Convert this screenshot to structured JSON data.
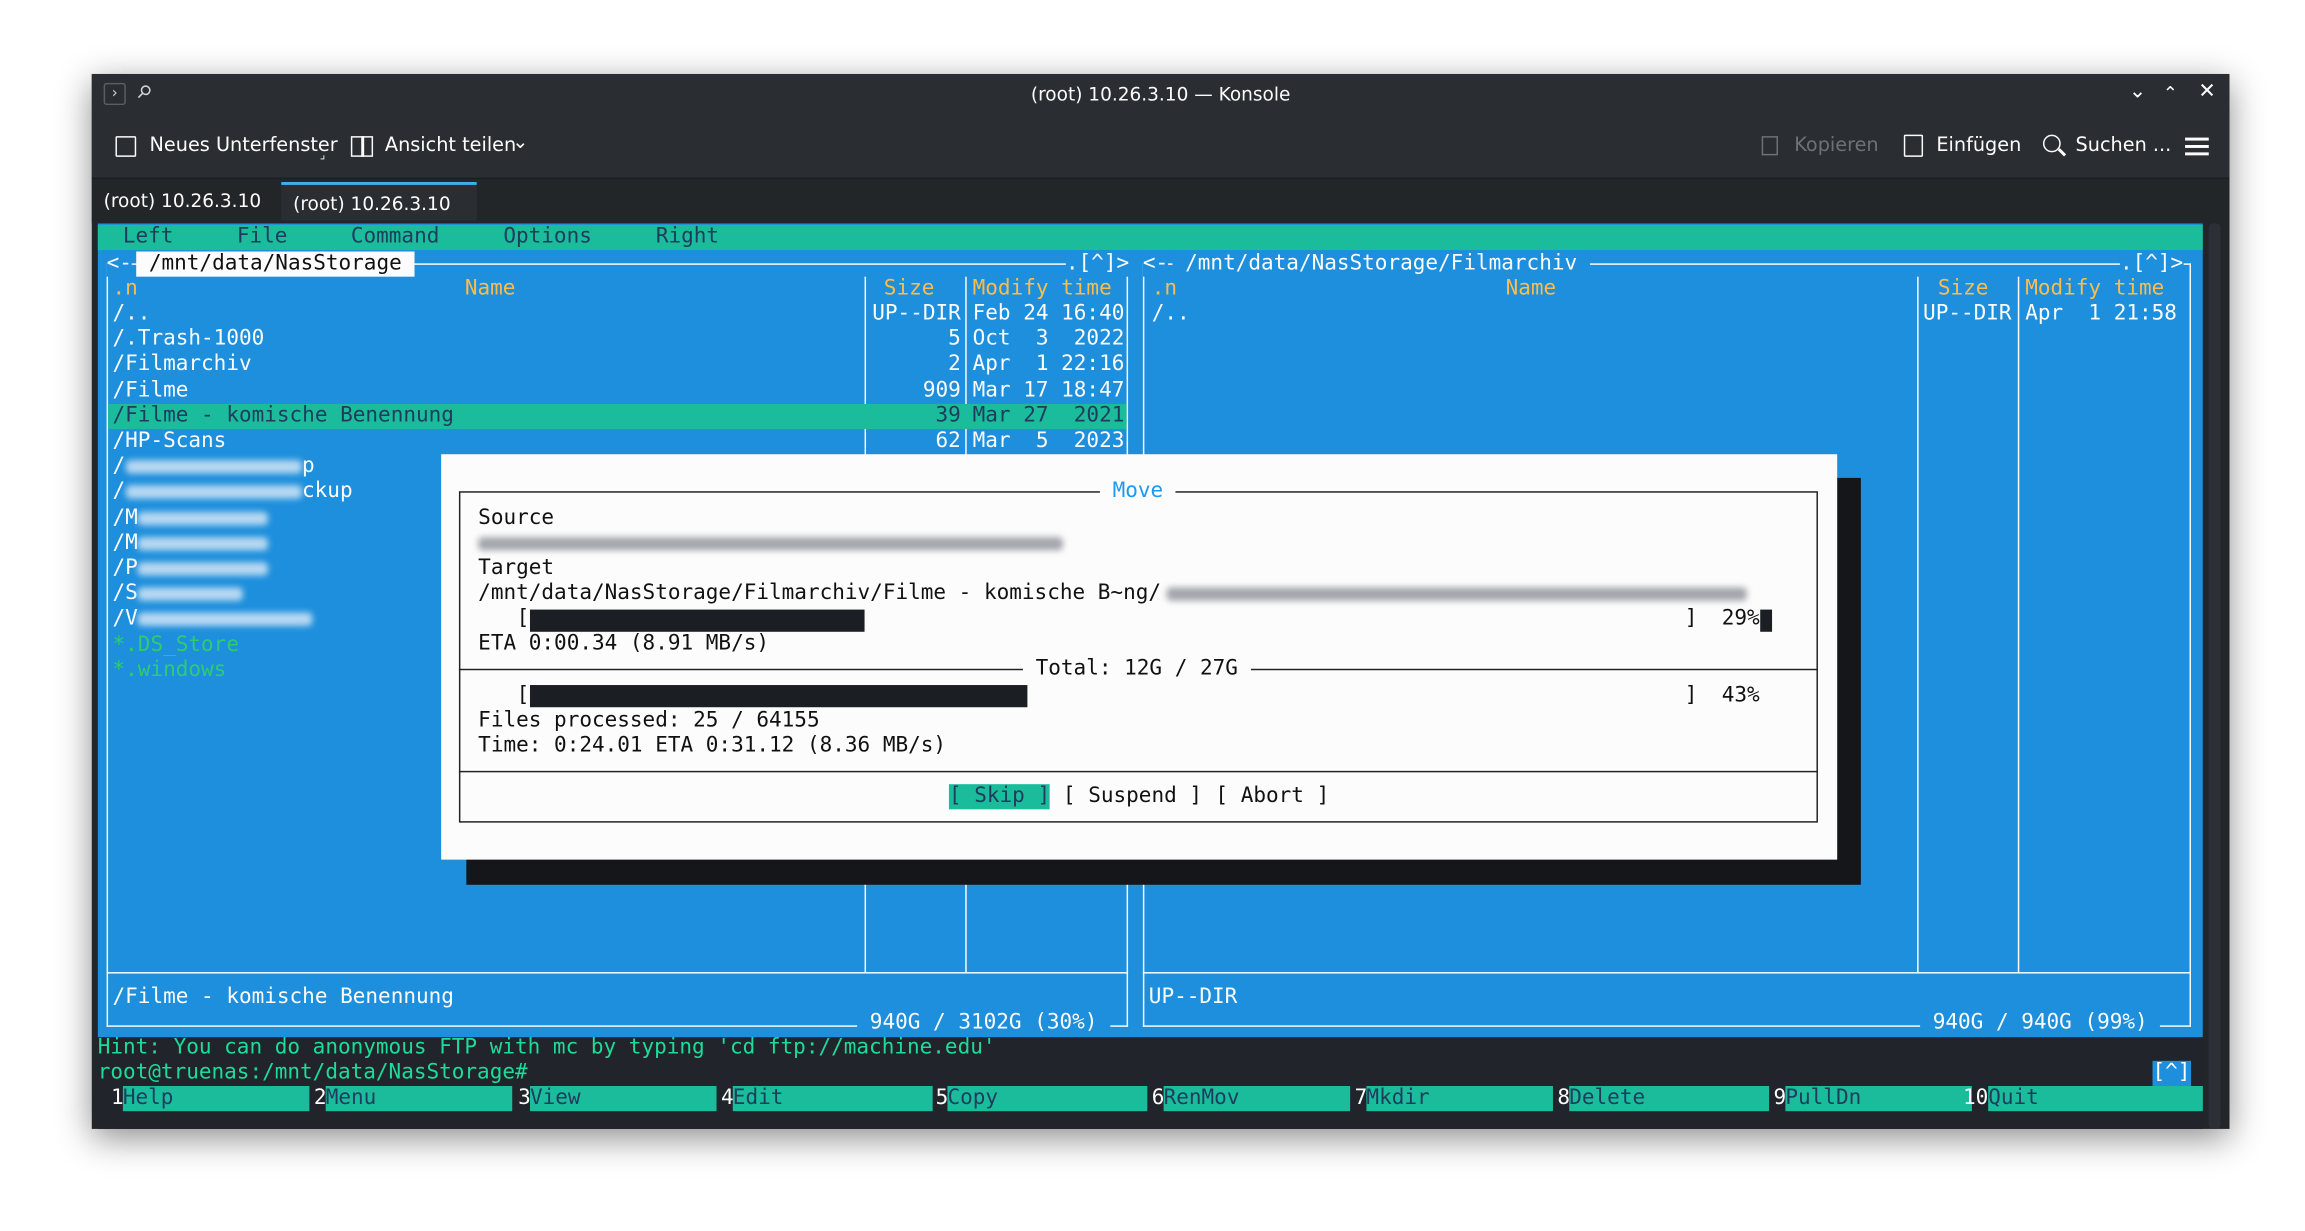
{
  "window": {
    "title": "(root) 10.26.3.10 — Konsole"
  },
  "toolbar": {
    "new_tab": "Neues Unterfenster",
    "split_view": "Ansicht teilen",
    "copy": "Kopieren",
    "paste": "Einfügen",
    "find": "Suchen ..."
  },
  "tabs": [
    {
      "label": "(root) 10.26.3.10"
    },
    {
      "label": "(root) 10.26.3.10"
    }
  ],
  "mc": {
    "menu": [
      "Left",
      "File",
      "Command",
      "Options",
      "Right"
    ],
    "left": {
      "path": " /mnt/data/NasStorage ",
      "sort": ".n",
      "col_name": "Name",
      "col_size": "Size",
      "col_time": "Modify time",
      "rows": [
        {
          "name": "/..",
          "size": "UP--DIR",
          "time": "Feb 24 16:40"
        },
        {
          "name": "/.Trash-1000",
          "size": "5",
          "time": "Oct  3  2022"
        },
        {
          "name": "/Filmarchiv",
          "size": "2",
          "time": "Apr  1 22:16"
        },
        {
          "name": "/Filme",
          "size": "909",
          "time": "Mar 17 18:47"
        },
        {
          "name": "/Filme - komische Benennung",
          "size": "39",
          "time": "Mar 27  2021"
        },
        {
          "name": "/HP-Scans",
          "size": "62",
          "time": "Mar  5  2023"
        }
      ],
      "partial": [
        {
          "a": "/",
          "b": "p"
        },
        {
          "a": "/",
          "b": "ckup"
        },
        {
          "a": "/M",
          "b": ""
        },
        {
          "a": "/M",
          "b": ""
        },
        {
          "a": "/P",
          "b": ""
        },
        {
          "a": "/S",
          "b": ""
        },
        {
          "a": "/V",
          "b": ""
        }
      ],
      "hidden": [
        "*.DS_Store",
        "*.windows"
      ],
      "status": "/Filme - komische Benennung",
      "free": " 940G / 3102G (30%) "
    },
    "right": {
      "path": " /mnt/data/NasStorage/Filmarchiv ",
      "sort": ".n",
      "col_name": "Name",
      "col_size": "Size",
      "col_time": "Modify time",
      "rows": [
        {
          "name": "/..",
          "size": "UP--DIR",
          "time": "Apr  1 21:58"
        }
      ],
      "status": "UP--DIR",
      "free": " 940G / 940G (99%) "
    },
    "dialog": {
      "title": " Move ",
      "source_label": "Source",
      "target_label": "Target",
      "target_path": "/mnt/data/NasStorage/Filmarchiv/Filme - komische B~ng/",
      "file_pct": "29%",
      "file_progress": 0.29,
      "eta": "ETA 0:00.34 (8.91 MB/s)",
      "total": " Total: 12G / 27G ",
      "total_pct": "43%",
      "total_progress": 0.43,
      "files": "Files processed: 25 / 64155",
      "time": "Time: 0:24.01 ETA 0:31.12 (8.36 MB/s)",
      "skip": "[ Skip ]",
      "suspend": "[ Suspend ]",
      "abort": "[ Abort ]"
    },
    "hint": "Hint: You can do anonymous FTP with mc by typing 'cd ftp://machine.edu'",
    "prompt": "root@truenas:/mnt/data/NasStorage#",
    "prompt_tag": "[^]",
    "panel_tag": ".[^]>",
    "fkeys": [
      {
        "num": "1",
        "label": "Help"
      },
      {
        "num": "2",
        "label": "Menu"
      },
      {
        "num": "3",
        "label": "View"
      },
      {
        "num": "4",
        "label": "Edit"
      },
      {
        "num": "5",
        "label": "Copy"
      },
      {
        "num": "6",
        "label": "RenMov"
      },
      {
        "num": "7",
        "label": "Mkdir"
      },
      {
        "num": "8",
        "label": "Delete"
      },
      {
        "num": "9",
        "label": "PullDn"
      },
      {
        "num": "10",
        "label": "Quit"
      }
    ]
  }
}
